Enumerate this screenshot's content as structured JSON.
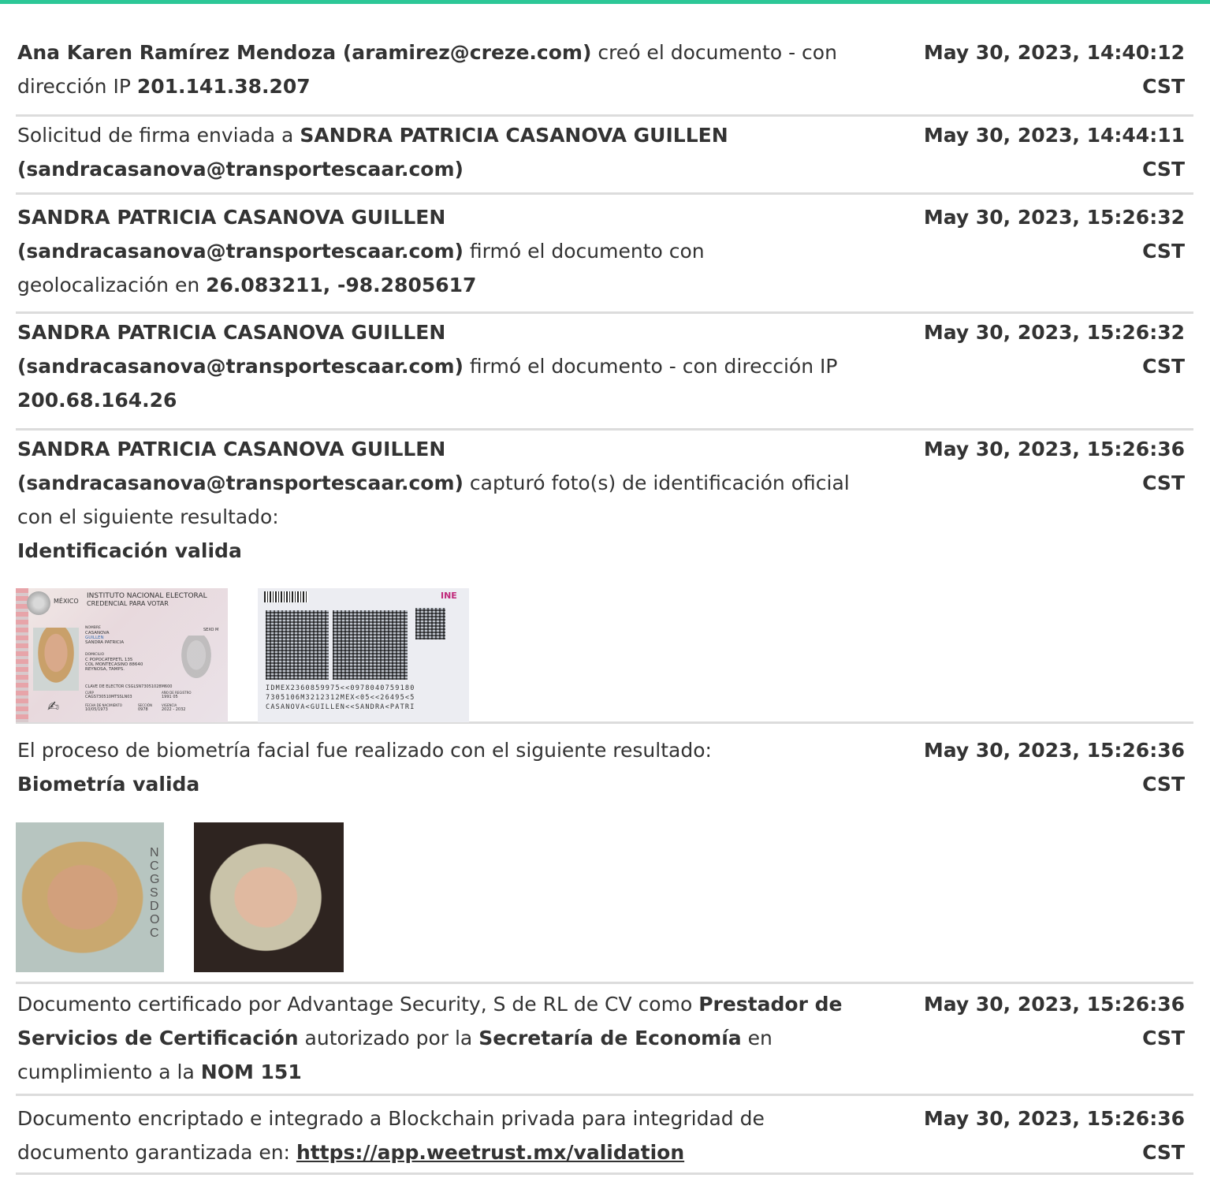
{
  "colors": {
    "accent_bar": "#2cc797",
    "text": "#333333",
    "divider": "#dcdcdc"
  },
  "rows": [
    {
      "parts": [
        {
          "t": "Ana Karen Ramírez Mendoza (aramirez@creze.com)",
          "b": true
        },
        {
          "t": " creó el documento - con dirección IP "
        },
        {
          "t": "201.141.38.207",
          "b": true
        }
      ],
      "timestamp": "May 30, 2023, 14:40:12 CST"
    },
    {
      "parts": [
        {
          "t": "Solicitud de firma enviada a "
        },
        {
          "t": "SANDRA PATRICIA CASANOVA GUILLEN (sandracasanova@transportescaar.com)",
          "b": true
        }
      ],
      "timestamp": "May 30, 2023, 14:44:11 CST"
    },
    {
      "parts": [
        {
          "t": "SANDRA PATRICIA CASANOVA GUILLEN (sandracasanova@transportescaar.com)",
          "b": true
        },
        {
          "t": " firmó el documento con geolocalización en "
        },
        {
          "t": "26.083211, -98.2805617",
          "b": true
        }
      ],
      "timestamp": "May 30, 2023, 15:26:32 CST"
    },
    {
      "parts": [
        {
          "t": "SANDRA PATRICIA CASANOVA GUILLEN (sandracasanova@transportescaar.com)",
          "b": true
        },
        {
          "t": " firmó el documento - con dirección IP "
        },
        {
          "t": "200.68.164.26",
          "b": true
        }
      ],
      "timestamp": "May 30, 2023, 15:26:32 CST"
    },
    {
      "parts": [
        {
          "t": "SANDRA PATRICIA CASANOVA GUILLEN (sandracasanova@transportescaar.com)",
          "b": true
        },
        {
          "t": " capturó foto(s) de identificación oficial con el siguiente resultado:"
        },
        {
          "t": "Identificación valida",
          "b": true,
          "br": true
        }
      ],
      "timestamp": "May 30, 2023, 15:26:36 CST"
    },
    {
      "parts": [
        {
          "t": "El proceso de biometría facial fue realizado con el siguiente resultado:"
        },
        {
          "t": "Biometría valida",
          "b": true,
          "br": true
        }
      ],
      "timestamp": "May 30, 2023, 15:26:36 CST"
    },
    {
      "parts": [
        {
          "t": "Documento certificado por Advantage Security, S de RL de CV como "
        },
        {
          "t": "Prestador de Servicios de Certificación",
          "b": true
        },
        {
          "t": " autorizado por la "
        },
        {
          "t": "Secretaría de Economía",
          "b": true
        },
        {
          "t": " en cumplimiento a la "
        },
        {
          "t": "NOM 151",
          "b": true
        }
      ],
      "timestamp": "May 30, 2023, 15:26:36 CST"
    },
    {
      "parts": [
        {
          "t": "Documento encriptado e integrado a Blockchain privada para integridad de documento garantizada en: "
        },
        {
          "t": "https://app.weetrust.mx/validation",
          "link": true
        }
      ],
      "timestamp": "May 30, 2023, 15:26:36 CST"
    }
  ],
  "id_front": {
    "country": "MÉXICO",
    "institute": "INSTITUTO NACIONAL ELECTORAL",
    "card_type": "CREDENCIAL PARA VOTAR",
    "sex": "SEXO M",
    "name_label": "NOMBRE",
    "name_lines": [
      "CASANOVA",
      "GUILLEN",
      "SANDRA PATRICIA"
    ],
    "address_label": "DOMICILIO",
    "address_lines": [
      "C POPOCATEPETL 135",
      "COL MONTECASINO 88640",
      "REYNOSA, TAMPS."
    ],
    "elector_key": "CLAVE DE ELECTOR  CSGLSN73051028M600",
    "curp_label": "CURP",
    "curp": "CAGS730510MTSSLN03",
    "reg_label": "AÑO DE REGISTRO",
    "reg": "1991 05",
    "dob_label": "FECHA DE NACIMIENTO",
    "dob": "10/05/1973",
    "section_label": "SECCIÓN",
    "section": "0978",
    "validity_label": "VIGENCIA",
    "validity": "2022 - 2032"
  },
  "id_back": {
    "logo": "INE",
    "mrz": [
      "IDMEX2360859975<<0978040759180",
      "7305106M3212312MEX<05<<26495<5",
      "CASANOVA<GUILLEN<<SANDRA<PATRI"
    ]
  },
  "face_id_letters": "NCGSDOC"
}
